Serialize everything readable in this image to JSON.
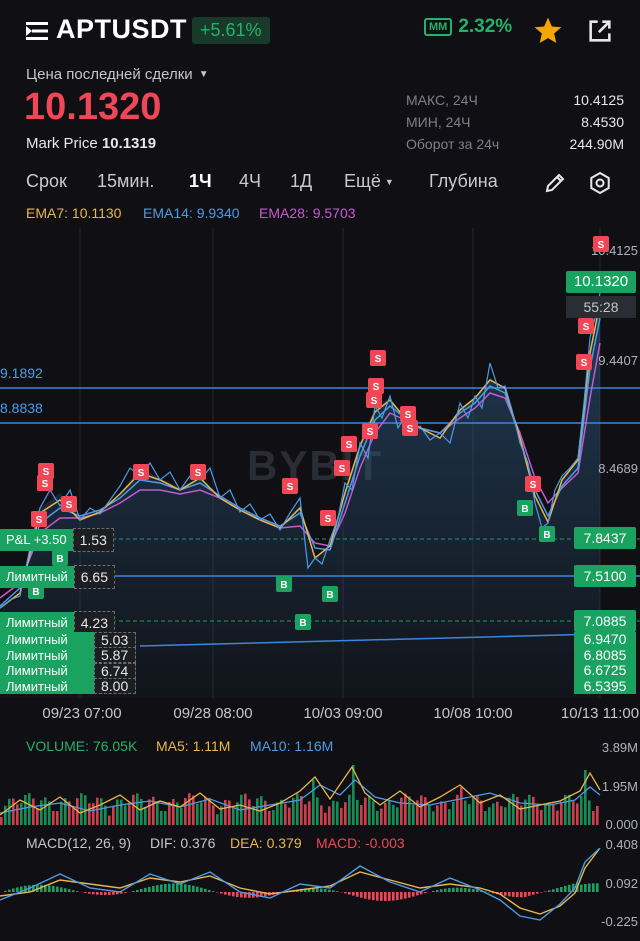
{
  "header": {
    "symbol": "APTUSDT",
    "change_pct": "+5.61%",
    "mm_label": "MM",
    "mm_value": "2.32%"
  },
  "price": {
    "last_label": "Цена последней сделки",
    "last_price": "10.1320",
    "mark_label": "Mark Price",
    "mark_value": "10.1319"
  },
  "stats": [
    {
      "label": "МАКС, 24Ч",
      "value": "10.4125"
    },
    {
      "label": "МИН, 24Ч",
      "value": "8.4530"
    },
    {
      "label": "Оборот за 24ч",
      "value": "244.90M"
    }
  ],
  "tabs": [
    "Срок",
    "15мин.",
    "1Ч",
    "4Ч",
    "1Д",
    "Ещё",
    "Глубина"
  ],
  "active_tab": "1Ч",
  "ema": {
    "ema7": "EMA7: 10.1130",
    "ema14": "EMA14: 9.9340",
    "ema28": "EMA28: 9.5703"
  },
  "chart": {
    "watermark": "BYBIT",
    "price_ticks": [
      "10.4125",
      "9.4407",
      "8.4689"
    ],
    "current_price": "10.1320",
    "countdown": "55:28",
    "hlines_left": [
      "9.1892",
      "8.8838"
    ],
    "pnl_label": "P&L +3.50",
    "pnl_qty": "1.53",
    "pnl_price": "7.8437",
    "order1_label": "Лимитный",
    "order1_qty": "6.65",
    "order1_price": "7.5100",
    "order2_label": "Лимитный",
    "order2_qty": "4.23",
    "order2_price": "7.0885",
    "stacked_orders": [
      {
        "label": "Лимитный",
        "qty": "5.03",
        "price": "6.9470"
      },
      {
        "label": "Лимитный",
        "qty": "5.87",
        "price": "6.8085"
      },
      {
        "label": "Лимитный",
        "qty": "6.74",
        "price": "6.6725"
      },
      {
        "label": "Лимитный",
        "qty": "8.00",
        "price": "6.5395"
      }
    ],
    "date_ticks": [
      "09/23 07:00",
      "09/28 08:00",
      "10/03 09:00",
      "10/08 10:00",
      "10/13 11:00"
    ],
    "sell_marker": "S",
    "buy_marker": "B"
  },
  "volume": {
    "label": "VOLUME: 76.05K",
    "ma5": "MA5: 1.11M",
    "ma10": "MA10: 1.16M",
    "ticks": [
      "3.89M",
      "1.95M",
      "0.000"
    ]
  },
  "macd": {
    "label": "MACD(12, 26, 9)",
    "dif": "DIF: 0.376",
    "dea": "DEA: 0.379",
    "macd": "MACD: -0.003",
    "ticks": [
      "0.408",
      "0.092",
      "-0.225"
    ]
  },
  "colors": {
    "up": "#1aa260",
    "down": "#f04757",
    "ema7": "#e8b64a",
    "ema14": "#4d9be6",
    "ema28": "#c45ad0",
    "star": "#f7a600"
  }
}
